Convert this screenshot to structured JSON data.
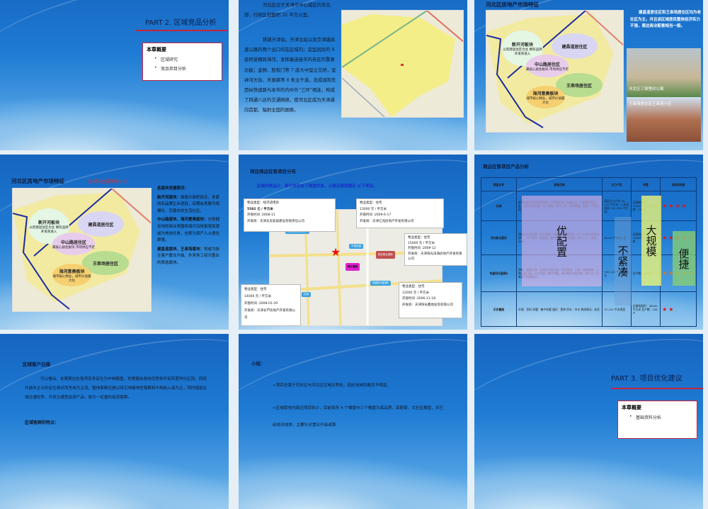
{
  "slides": [
    {
      "title": "PART 2.  区域竞品分析",
      "summary_title": "本章概要",
      "items": [
        "区域研究",
        "竞品项目分析"
      ]
    },
    {
      "paragraphs": [
        "河北区位于天津市中心城区的东北部，行政区划面积 32 平方公里。",
        "铁路天津站、天津北站以及京津塘高速公路的两个出口均在区域内；造型迥异的 8 座桥梁横跨海河，发挥着连接市内各区的重要功能；金狮、民权门等 7 座大中型立交桥，金钟河大街、天泰路等 8 条主干道，志成道和东西纵快速路与本市的内中外“三环”相连，构成了四通八达的交通网络，使河北区成为天津通向首都、辐射全国的圈索。"
      ]
    },
    {
      "title": "河北区房地产市场特征",
      "text": "建昌道居住区和王串场居住区均为老社区为主，并且该区域居民整体经济实力不强，周边商业配套相当一般。",
      "photo1": "河北区三钢里欣公寓",
      "photo2": "王串场居住区王串场小区"
    },
    {
      "title": "河北区房地产市场特征",
      "subtitle": "区域内主要两级分化",
      "sec_title": "各版块发展情况：",
      "blocks": [
        {
          "h": "新开河版块：",
          "t": "面临大面积拆迁，多家知名品牌企业进驻，后期会发展为规模化、完善化的生活社区。"
        },
        {
          "h": "中山路版块、海河意奥版块：",
          "t": "分别拥有地段商业氛围和海河沿线景观资源成为地块珍贵，也称为资产人士居住群落。"
        },
        {
          "h": "建昌道版块、王串场版块：",
          "t": "将成为拆迁客户置业升级、外来务工初次置业的首选版块。"
        }
      ]
    },
    {
      "title": "项目周边在售项目分布",
      "subtitle": "区域内竞品少，部分项目处于尾盘状态，以就近原则锁定 以下项目。",
      "callouts": [
        [
          "物业类型：经济适用房",
          "5582 元 / 平方米",
          "开盘时间 :2008-11",
          "开发商：天津东房安居建设有限责任公司"
        ],
        [
          "物业类型：住宅",
          "13000 元 / 平方米",
          "开盘时间 :2009-6-17",
          "开发商：天津亿兆房地产开发有限公司"
        ],
        [
          "物业类型：住宅",
          "15000 元 / 平方米",
          "开盘时间 :2009-12",
          "开发商：天津阳光滨海房地产开发有限公司"
        ],
        [
          "物业类型：住宅",
          "14000 元 / 平方米",
          "开盘时间 :2008-01-29",
          "开发商：天津长芦房地产开发有限公司"
        ],
        [
          "物业类型：住宅",
          "12000 元 / 平方米",
          "开盘时间 :2006-11-18",
          "开发商：天津阳光鑫地投资有限公司"
        ]
      ],
      "pins": [
        "嘉里道经济适用房",
        "千禧花园",
        "阳光新业国际",
        "靖江嘉园",
        "恒盛阳光星期8",
        "红城"
      ]
    },
    {
      "title": "周边在售项目产品分析",
      "headers": [
        "楼盘名称",
        "配套设施",
        "主力户型",
        "体量",
        "地段成熟度"
      ],
      "rows": [
        {
          "name": "红城",
          "facility": "本项目外墙采用高级涂料，大堂精装修，电梯迅达，门窗断桥铝合金，采用中央空调，分户采暖，燃气入户，有线电视，宽带，可视对讲。",
          "type": "高层主力户型 90-120 平方米，小高层跃层 120-160 平方米。",
          "volume": "总建筑面积：140000 平方米 总户数：1500",
          "stars": "★★★★"
        },
        {
          "name": "阳光新业国际",
          "facility": "涂料外立面内墙：四白落地，精装电梯，直径主入户门为电控可视对讲门，分户防火，防盗窗，集中供暖，中水系统，燃气入户，宽带：10M。",
          "type": "90-93 平方米二室",
          "volume": "总建筑面积：160000 平方米 总户数",
          "stars": "★★★★★"
        },
        {
          "name": "恒盛阳光星期8",
          "facility": "涂料：粗骨外墙，石材外立面内墙：四白落地，大堂：精装电梯：上海三菱门窗，分户防盗，集中供暖，单户循环供热系统，每户至少设有两个终端接口。",
          "type": "100-120 平方米为主",
          "volume": "总户数：3695 户",
          "stars": "★★★★★"
        },
        {
          "name": "乐东馨园",
          "facility": "外墙：涂料 采暖：集中采暖 通讯：宽带 供水：市水 装修情况：毛坯",
          "type": "97-100 平米两居",
          "volume": "总建筑面积：38300 平方米 总户数：148 户",
          "stars": "★★"
        }
      ],
      "overlays": {
        "pink": "优配置",
        "blue": "不紧凑",
        "yellow": "大规模",
        "green": "便捷"
      }
    },
    {
      "title": "区域客户白描",
      "paragraph": "可以看出，本案周边在售项目多定位为中档楼盘，并根据自身的优势条件有所差异化区别，而现代城市主义的定位相对而言成为主流，整体客群还是以吸引地缘地性客群和中档收入者为主，同时借助区域交通优势，开发交通型投资产品，吸引一定量的投资客群。",
      "sub": "区域客群的特点："
    },
    {
      "title": "小结：",
      "bullets": [
        "项目坐落于河东区与河北区区域交界处，因此地域性概念不明显。",
        "区域版块内周边项目较少，目前现存 4 个楼盘中三个楼盘为高品质，高配套，大社区楼盘，并已经相对成熟，主要针对置业升级或首"
      ]
    },
    {
      "title": "PART 3.  项目优化建议",
      "summary_title": "本章概要",
      "items": [
        "基础资料分析"
      ]
    }
  ],
  "map_regions": {
    "r1": "新开河板块",
    "r1s": "以新建居住区为主 拥有品牌开发商进入",
    "r2": "建昌道居住区",
    "r3": "中山路居住区",
    "r3s": "最核心居住板块 市场供应不足",
    "r4": "王串场居住区",
    "r5": "海河意奥板块",
    "r5s": "城市核心物业，城市价值最大化"
  },
  "colors": {
    "accent_red": "#c4243e",
    "title_blue": "#1a2cc8"
  }
}
